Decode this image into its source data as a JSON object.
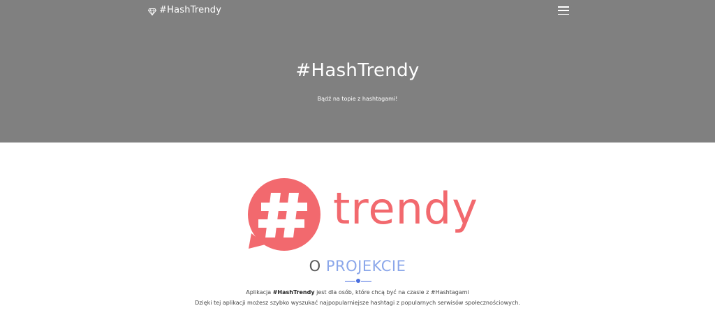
{
  "navbar": {
    "brand_icon": "diamond-icon",
    "brand_text": "#HashTrendy",
    "menu_icon": "hamburger-menu-icon"
  },
  "hero": {
    "title": "#HashTrendy",
    "subtitle": "Bądź na topie z hashtagami!"
  },
  "logo": {
    "symbol": "#",
    "word": "trendy",
    "color": "#f2696e"
  },
  "about": {
    "title_part1": "O",
    "title_part2": "PROJEKCIE",
    "line1_prefix": "Aplikacja",
    "line1_bold": "#HashTrendy",
    "line1_suffix": "jest dla osób, które chcą być na czasie z #Hashtagami",
    "line2": "Dzięki tej aplikacji możesz szybko wyszukać najpopularniejsze hashtagi z popularnych serwisów społecznościowych."
  },
  "colors": {
    "hero_bg": "#808080",
    "accent": "#4a6fe0",
    "logo": "#f2696e"
  }
}
